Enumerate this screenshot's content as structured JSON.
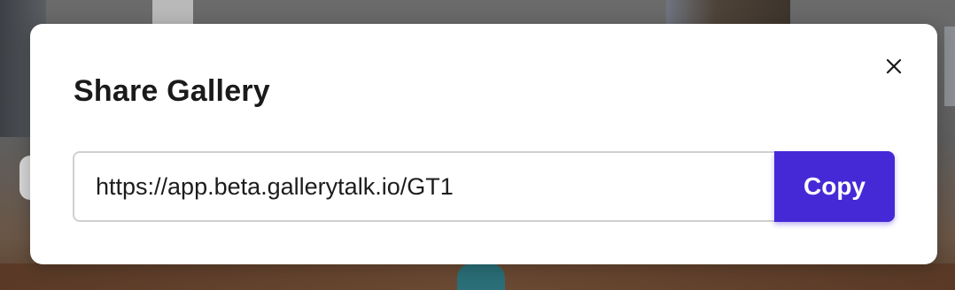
{
  "dialog": {
    "title": "Share Gallery",
    "close_icon": "close-icon",
    "share_link": "https://app.beta.gallerytalk.io/GT1",
    "copy_label": "Copy"
  },
  "colors": {
    "accent": "#4629d6",
    "modal_background": "#ffffff",
    "title_text": "#1a1a1a",
    "input_border": "#d0d0d0"
  }
}
